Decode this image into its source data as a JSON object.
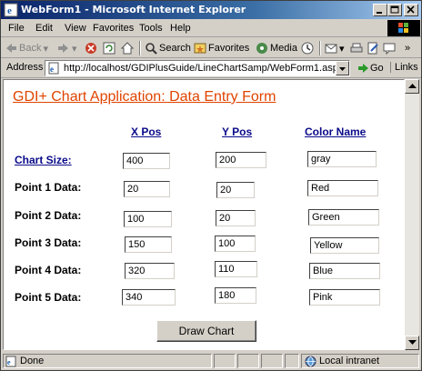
{
  "window": {
    "title": "WebForm1 - Microsoft Internet Explorer"
  },
  "menu": [
    "File",
    "Edit",
    "View",
    "Favorites",
    "Tools",
    "Help"
  ],
  "toolbar": {
    "back": "Back",
    "search": "Search",
    "favorites": "Favorites",
    "media": "Media"
  },
  "address": {
    "label": "Address",
    "url": "http://localhost/GDIPlusGuide/LineChartSamp/WebForm1.aspx",
    "go": "Go",
    "links": "Links"
  },
  "form": {
    "title": "GDI+ Chart Application: Data Entry Form",
    "columns": [
      "X Pos",
      "Y Pos",
      "Color Name"
    ],
    "chart_size": {
      "label": "Chart Size:",
      "x": "400",
      "y": "200",
      "color": "gray"
    },
    "points": [
      {
        "label": "Point 1 Data:",
        "x": "20",
        "y": "20",
        "color": "Red"
      },
      {
        "label": "Point 2 Data:",
        "x": "100",
        "y": "20",
        "color": "Green"
      },
      {
        "label": "Point 3 Data:",
        "x": "150",
        "y": "100",
        "color": "Yellow"
      },
      {
        "label": "Point 4 Data:",
        "x": "320",
        "y": "110",
        "color": "Blue"
      },
      {
        "label": "Point 5 Data:",
        "x": "340",
        "y": "180",
        "color": "Pink"
      }
    ],
    "button": "Draw Chart"
  },
  "status": {
    "text": "Done",
    "zone": "Local intranet"
  },
  "colors": {
    "heading": "#e04400",
    "link": "#0a0a8a",
    "titlebar": "#0a246a"
  },
  "icons": [
    "ie-icon",
    "minimize-icon",
    "maximize-icon",
    "close-icon",
    "back-arrow-icon",
    "forward-arrow-icon",
    "stop-icon",
    "refresh-icon",
    "home-icon",
    "search-icon",
    "favorites-icon",
    "media-icon",
    "history-icon",
    "mail-icon",
    "print-icon",
    "edit-icon",
    "discuss-icon",
    "page-icon",
    "go-arrow-icon",
    "globe-icon"
  ]
}
